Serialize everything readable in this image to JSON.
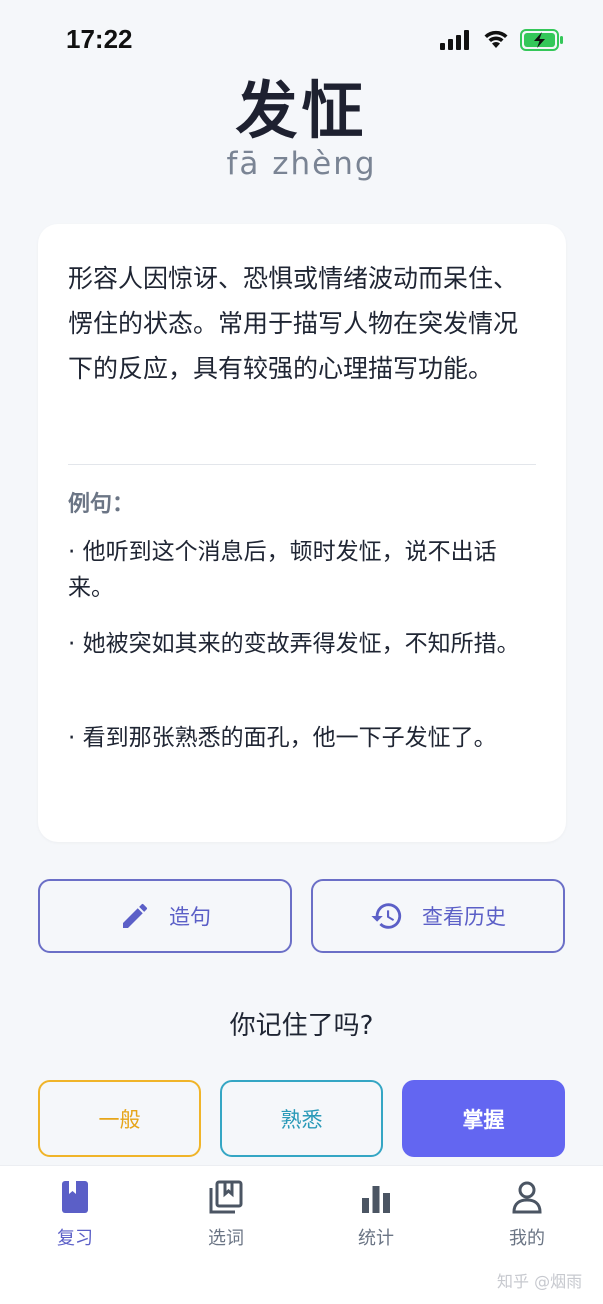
{
  "status_bar": {
    "time": "17:22"
  },
  "word": {
    "title": "发怔",
    "pinyin": "fā zhèng"
  },
  "card": {
    "definition": "形容人因惊讶、恐惧或情绪波动而呆住、愣住的状态。常用于描写人物在突发情况下的反应，具有较强的心理描写功能。",
    "examples_label": "例句：",
    "examples": [
      "· 他听到这个消息后，顿时发怔，说不出话来。",
      "· 她被突如其来的变故弄得发怔，不知所措。",
      "· 看到那张熟悉的面孔，他一下子发怔了。"
    ]
  },
  "actions": {
    "sentence": "造句",
    "history": "查看历史"
  },
  "question": "你记住了吗?",
  "rating": {
    "normal": "一般",
    "familiar": "熟悉",
    "master": "掌握"
  },
  "tabs": [
    {
      "label": "复习",
      "icon": "book-icon",
      "active": true
    },
    {
      "label": "选词",
      "icon": "library-icon",
      "active": false
    },
    {
      "label": "统计",
      "icon": "bar-chart-icon",
      "active": false
    },
    {
      "label": "我的",
      "icon": "person-icon",
      "active": false
    }
  ],
  "watermark": "知乎 @烟雨",
  "colors": {
    "accent": "#6366f1",
    "normal": "#f0b429",
    "familiar": "#35a6c4",
    "background": "#f5f7fa"
  }
}
